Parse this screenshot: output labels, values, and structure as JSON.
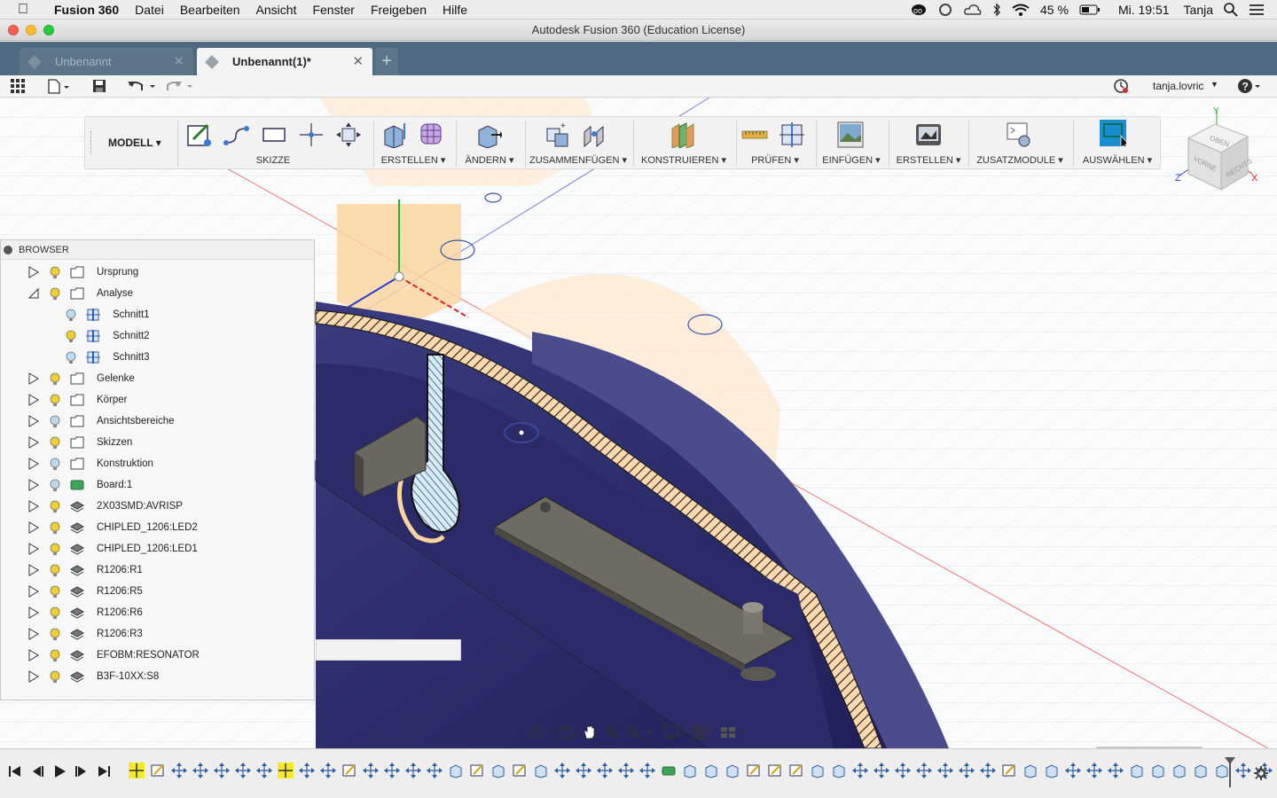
{
  "menubar": {
    "app_name": "Fusion 360",
    "items": [
      "Datei",
      "Bearbeiten",
      "Ansicht",
      "Fenster",
      "Freigeben",
      "Hilfe"
    ],
    "battery": "45 %",
    "clock": "Mi. 19:51",
    "user": "Tanja"
  },
  "window": {
    "title": "Autodesk Fusion 360 (Education License)"
  },
  "tabs": [
    {
      "label": "Unbenannt"
    },
    {
      "label": "Unbenannt(1)*"
    }
  ],
  "qat": {
    "user": "tanja.lovric"
  },
  "ribbon": {
    "workspace": "MODELL",
    "groups": [
      "SKIZZE",
      "ERSTELLEN",
      "ÄNDERN",
      "ZUSAMMENFÜGEN",
      "KONSTRUIEREN",
      "PRÜFEN",
      "EINFÜGEN",
      "ERSTELLEN",
      "ZUSATZMODULE",
      "AUSWÄHLEN"
    ]
  },
  "browser": {
    "title": "BROWSER",
    "items": [
      {
        "label": "Ursprung",
        "kind": "folder",
        "state": "collapsed",
        "bulb": "yellow",
        "indent": 0
      },
      {
        "label": "Analyse",
        "kind": "folder",
        "state": "expanded",
        "bulb": "yellow",
        "indent": 0
      },
      {
        "label": "Schnitt1",
        "kind": "section",
        "state": "leaf",
        "bulb": "blue",
        "indent": 1
      },
      {
        "label": "Schnitt2",
        "kind": "section",
        "state": "leaf",
        "bulb": "yellow",
        "indent": 1
      },
      {
        "label": "Schnitt3",
        "kind": "section",
        "state": "leaf",
        "bulb": "blue",
        "indent": 1
      },
      {
        "label": "Gelenke",
        "kind": "folder",
        "state": "collapsed",
        "bulb": "yellow",
        "indent": 0
      },
      {
        "label": "Körper",
        "kind": "folder",
        "state": "collapsed",
        "bulb": "yellow",
        "indent": 0
      },
      {
        "label": "Ansichtsbereiche",
        "kind": "folder",
        "state": "collapsed",
        "bulb": "blue",
        "indent": 0
      },
      {
        "label": "Skizzen",
        "kind": "folder",
        "state": "collapsed",
        "bulb": "yellow",
        "indent": 0
      },
      {
        "label": "Konstruktion",
        "kind": "folder",
        "state": "collapsed",
        "bulb": "blue",
        "indent": 0
      },
      {
        "label": "Board:1",
        "kind": "board",
        "state": "collapsed",
        "bulb": "blue",
        "indent": 0
      },
      {
        "label": "2X03SMD:AVRISP",
        "kind": "component",
        "state": "collapsed",
        "bulb": "yellow",
        "indent": 0
      },
      {
        "label": "CHIPLED_1206:LED2",
        "kind": "component",
        "state": "collapsed",
        "bulb": "yellow",
        "indent": 0
      },
      {
        "label": "CHIPLED_1206:LED1",
        "kind": "component",
        "state": "collapsed",
        "bulb": "yellow",
        "indent": 0
      },
      {
        "label": "R1206:R1",
        "kind": "component",
        "state": "collapsed",
        "bulb": "yellow",
        "indent": 0
      },
      {
        "label": "R1206:R5",
        "kind": "component",
        "state": "collapsed",
        "bulb": "yellow",
        "indent": 0
      },
      {
        "label": "R1206:R6",
        "kind": "component",
        "state": "collapsed",
        "bulb": "yellow",
        "indent": 0
      },
      {
        "label": "R1206:R3",
        "kind": "component",
        "state": "collapsed",
        "bulb": "yellow",
        "indent": 0
      },
      {
        "label": "EFOBM:RESONATOR",
        "kind": "component",
        "state": "collapsed",
        "bulb": "yellow",
        "indent": 0
      },
      {
        "label": "B3F-10XX:S8",
        "kind": "component",
        "state": "collapsed",
        "bulb": "yellow",
        "indent": 0
      }
    ]
  },
  "viewcube": {
    "top": "OBEN",
    "front": "VORNE",
    "right": "RECHTS",
    "axis_x": "X",
    "axis_y": "Y",
    "axis_z": "Z"
  },
  "colors": {
    "tabbar": "#4f6980",
    "model_dark": "#2e2d6e",
    "hatch": "#f5c99a",
    "select_accent": "#1a8ed1"
  }
}
